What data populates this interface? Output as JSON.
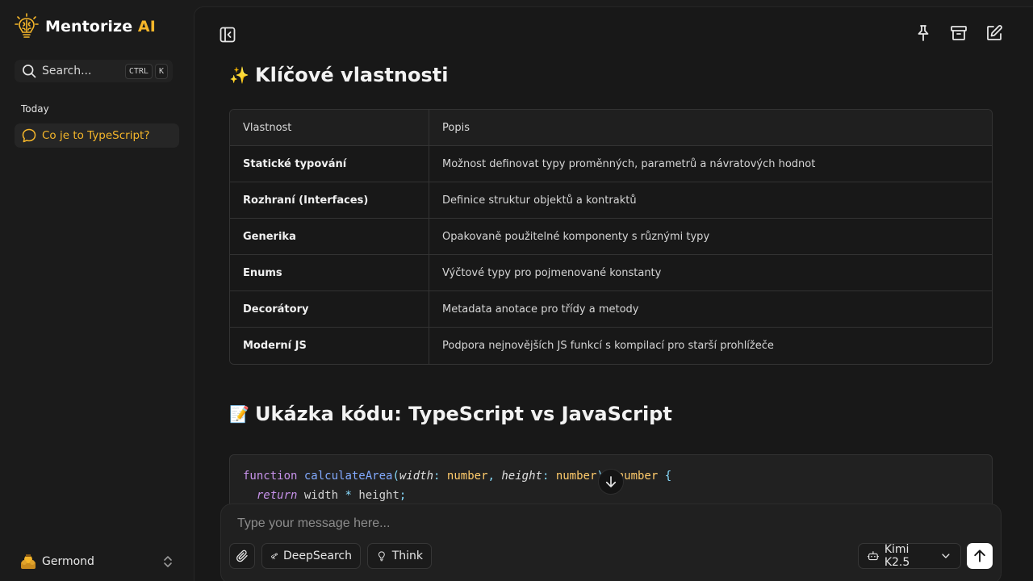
{
  "app": {
    "brand_main": "Mentorize",
    "brand_accent": "AI",
    "accent_color": "#f5b62a"
  },
  "sidebar": {
    "search_placeholder": "Search...",
    "shortcut_keys": [
      "CTRL",
      "K"
    ],
    "section_today": "Today",
    "chats": [
      {
        "title": "Co je to TypeScript?",
        "active": true
      }
    ],
    "user_name": "Germond"
  },
  "toolbar": {
    "icons": [
      "sidebar-toggle-icon",
      "pin-icon",
      "archive-icon",
      "new-chat-icon"
    ]
  },
  "content": {
    "section1_emoji": "✨",
    "section1_title": "Klíčové vlastnosti",
    "table": {
      "headers": [
        "Vlastnost",
        "Popis"
      ],
      "rows": [
        [
          "Statické typování",
          "Možnost definovat typy proměnných, parametrů a návratových hodnot"
        ],
        [
          "Rozhraní (Interfaces)",
          "Definice struktur objektů a kontraktů"
        ],
        [
          "Generika",
          "Opakovaně použitelné komponenty s různými typy"
        ],
        [
          "Enums",
          "Výčtové typy pro pojmenované konstanty"
        ],
        [
          "Decorátory",
          "Metadata anotace pro třídy a metody"
        ],
        [
          "Moderní JS",
          "Podpora nejnovějších JS funkcí s kompilací pro starší prohlížeče"
        ]
      ]
    },
    "section2_emoji": "📝",
    "section2_title": "Ukázka kódu: TypeScript vs JavaScript",
    "code_lines": [
      "function calculateArea(width: number, height: number): number {",
      "  return width * height;"
    ]
  },
  "composer": {
    "placeholder": "Type your message here...",
    "deepsearch_label": "DeepSearch",
    "think_label": "Think",
    "model_label": "Kimi K2.5"
  }
}
